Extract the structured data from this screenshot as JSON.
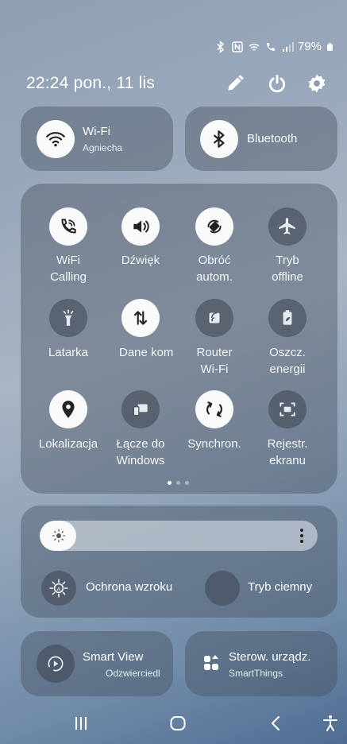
{
  "status_bar": {
    "battery": "79%",
    "icons": [
      "bluetooth-icon",
      "nfc-icon",
      "wifi-call-icon",
      "volte-icon",
      "signal-icon",
      "battery-icon"
    ]
  },
  "header": {
    "time": "22:24",
    "date": "pon., 11 lis",
    "icons": [
      "edit-icon",
      "power-icon",
      "settings-icon"
    ]
  },
  "wifi": {
    "label": "Wi-Fi",
    "network": "Agniecha"
  },
  "bluetooth": {
    "label": "Bluetooth"
  },
  "tiles": [
    {
      "label": "WiFi\nCalling",
      "icon": "wifi-calling-icon",
      "active": true
    },
    {
      "label": "Dźwięk",
      "icon": "volume-icon",
      "active": true
    },
    {
      "label": "Obróć\nautom.",
      "icon": "auto-rotate-icon",
      "active": true
    },
    {
      "label": "Tryb\noffline",
      "icon": "airplane-icon",
      "active": false
    },
    {
      "label": "Latarka",
      "icon": "flashlight-icon",
      "active": false
    },
    {
      "label": "Dane kom",
      "icon": "mobile-data-icon",
      "active": true
    },
    {
      "label": "Router\nWi-Fi",
      "icon": "hotspot-icon",
      "active": false
    },
    {
      "label": "Oszcz.\nenergii",
      "icon": "battery-saver-icon",
      "active": false
    },
    {
      "label": "Lokalizacja",
      "icon": "location-icon",
      "active": true
    },
    {
      "label": "Łącze do\nWindows",
      "icon": "link-to-windows-icon",
      "active": false
    },
    {
      "label": "Synchron.",
      "icon": "sync-icon",
      "active": true
    },
    {
      "label": "Rejestr.\nekranu",
      "icon": "screen-record-icon",
      "active": false
    }
  ],
  "page_indicator": {
    "pages": 3,
    "current": 1
  },
  "brightness": {
    "level": 0.13
  },
  "eye_comfort": {
    "label": "Ochrona wzroku"
  },
  "dark_mode": {
    "label": "Tryb ciemny"
  },
  "smart_view": {
    "label": "Smart View",
    "sub": "Odzwierciedl"
  },
  "smartthings": {
    "label": "Sterow. urządz.",
    "sub": "SmartThings"
  },
  "nav": [
    "recents-icon",
    "home-icon",
    "back-icon",
    "accessibility-icon"
  ]
}
